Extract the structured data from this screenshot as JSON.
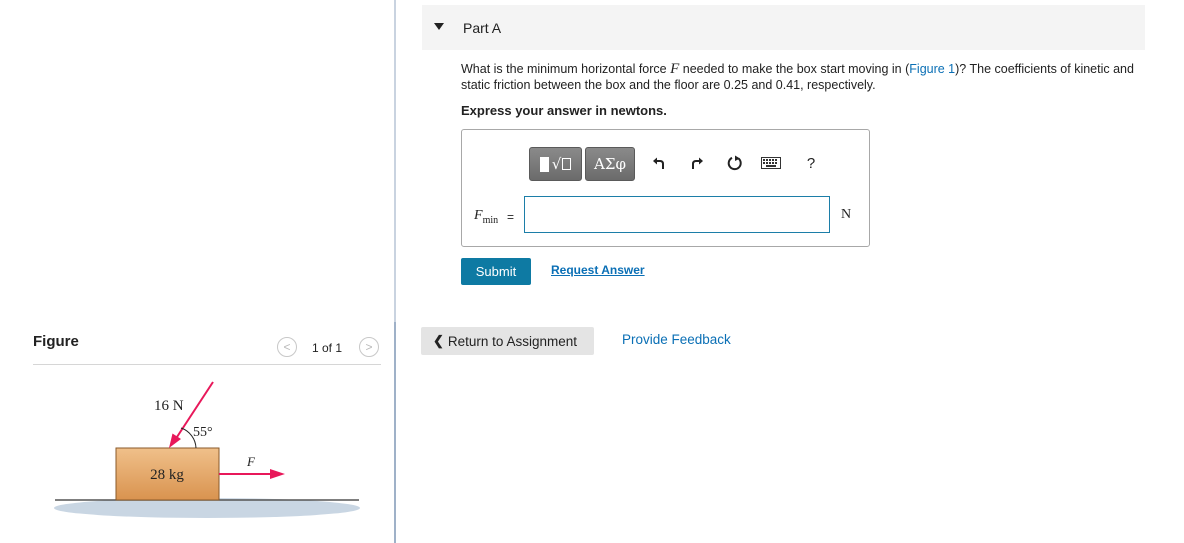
{
  "part": {
    "title": "Part A"
  },
  "question": {
    "text_before": "What is the minimum horizontal force ",
    "force_symbol": "F",
    "text_middle": " needed to make the box start moving in (",
    "figure_link": "Figure 1",
    "text_after": ")? The coefficients of kinetic and static friction between the box and the floor are 0.25 and 0.41, respectively."
  },
  "instruction": "Express your answer in newtons.",
  "toolbar": {
    "greek_label": "ΑΣφ",
    "help_label": "?",
    "icons": [
      "templates-icon",
      "greek-letters-icon",
      "undo-icon",
      "redo-icon",
      "reset-icon",
      "keyboard-icon",
      "help-icon"
    ]
  },
  "answer": {
    "symbol": "F",
    "subscript": "min",
    "equals": "=",
    "value": "",
    "unit": "N"
  },
  "actions": {
    "submit": "Submit",
    "request_answer": "Request Answer",
    "return": "Return to Assignment",
    "feedback": "Provide Feedback"
  },
  "figure": {
    "heading": "Figure",
    "counter": "1 of 1",
    "labels": {
      "applied_force": "16 N",
      "angle": "55°",
      "mass": "28 kg",
      "horizontal_force": "F"
    }
  },
  "colors": {
    "accent": "#0e7aa3",
    "link": "#0a6fb5",
    "box": "#e2a565",
    "arrow": "#e8185a",
    "floor": "#c9d6e3"
  }
}
